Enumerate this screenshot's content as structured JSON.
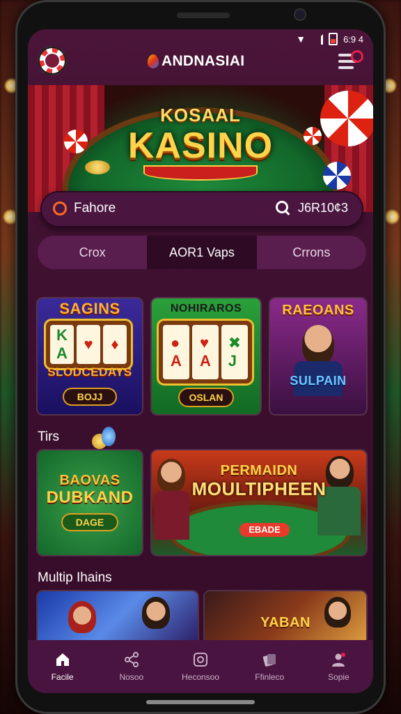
{
  "app": {
    "brand": "ANDNASIAI"
  },
  "status_bar": {
    "time": "6:9 4"
  },
  "hero": {
    "subtitle": "KOSAAL",
    "title": "KASINO"
  },
  "search": {
    "value": "Fahore",
    "code": "J6R10¢3"
  },
  "tabs": [
    {
      "label": "Crox",
      "active": false
    },
    {
      "label": "AOR1 Vaps",
      "active": true
    },
    {
      "label": "Crrons",
      "active": false
    }
  ],
  "games_row1": [
    {
      "title": "SAGINS",
      "subtitle": "SLODCEDAYS",
      "button": "BOJJ"
    },
    {
      "title": "NOHIRAROS",
      "button": "OSLAN"
    },
    {
      "title": "RAEOANS",
      "subtitle": "SULPAIN"
    }
  ],
  "section_tips": {
    "title": "Tirs"
  },
  "games_row2": [
    {
      "title_line1": "BAOVAS",
      "title_line2": "DUBKAND",
      "button": "DAGE"
    },
    {
      "title_line1": "PERMAIDN",
      "title_line2": "MOULTIPHEEN",
      "button": "EBADE"
    }
  ],
  "section_multi": {
    "title": "Multip Ihains"
  },
  "games_row3": [
    {
      "title": ""
    },
    {
      "title": "YABAN"
    }
  ],
  "bottom_nav": [
    {
      "label": "Facile",
      "icon": "home-icon",
      "active": true
    },
    {
      "label": "Nosoo",
      "icon": "share-icon",
      "active": false
    },
    {
      "label": "Heconsoo",
      "icon": "gamepad-icon",
      "active": false
    },
    {
      "label": "Ffinleco",
      "icon": "cards-icon",
      "active": false
    },
    {
      "label": "Sopie",
      "icon": "profile-icon",
      "active": false
    }
  ],
  "colors": {
    "screen_bg": "#3c0f2e",
    "accent_gold": "#ffd34a",
    "accent_red": "#e8204a",
    "felt_green": "#1f8a3a"
  }
}
